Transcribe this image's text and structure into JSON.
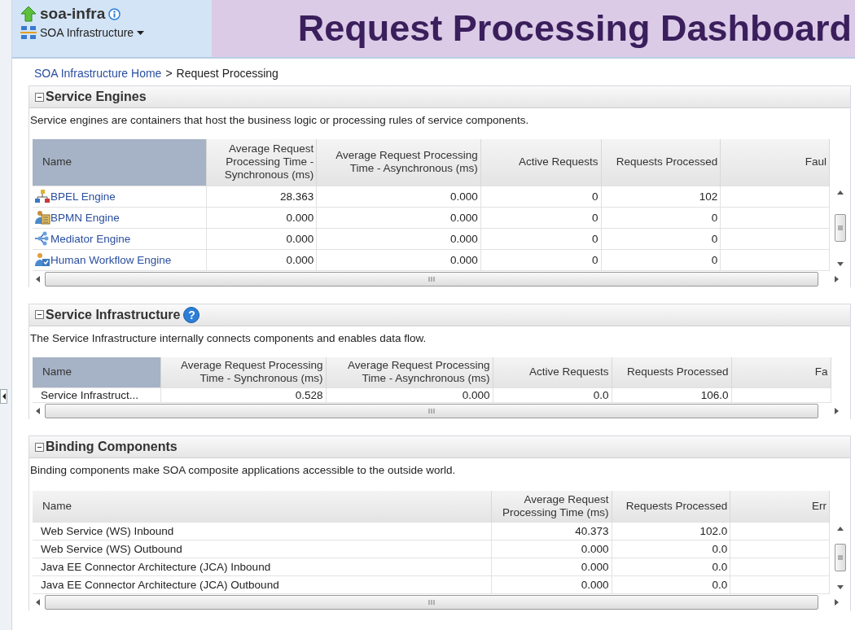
{
  "header": {
    "app_name": "soa-infra",
    "target_menu": "SOA Infrastructure",
    "title": "Request Processing Dashboard"
  },
  "breadcrumb": {
    "link": "SOA Infrastructure Home",
    "separator": ">",
    "current": "Request Processing"
  },
  "panels": [
    {
      "title": "Service Engines",
      "expanded": true,
      "description": "Service engines are containers that host the business logic or processing rules of service components.",
      "table": {
        "name_links": true,
        "vertical_scroll": true,
        "columns": [
          {
            "label": "Name",
            "selected": true
          },
          {
            "label": "Average Request Processing Time - Synchronous (ms)",
            "selected": false
          },
          {
            "label": "Average Request Processing Time - Asynchronous (ms)",
            "selected": false
          },
          {
            "label": "Active Requests",
            "selected": false
          },
          {
            "label": "Requests Processed",
            "selected": false
          },
          {
            "label": "Faul",
            "selected": false
          }
        ],
        "rows": [
          {
            "cells": [
              "BPEL Engine",
              "28.363",
              "0.000",
              "0",
              "102"
            ]
          },
          {
            "cells": [
              "BPMN Engine",
              "0.000",
              "0.000",
              "0",
              "0"
            ]
          },
          {
            "cells": [
              "Mediator Engine",
              "0.000",
              "0.000",
              "0",
              "0"
            ]
          },
          {
            "cells": [
              "Human Workflow Engine",
              "0.000",
              "0.000",
              "0",
              "0"
            ]
          }
        ]
      }
    },
    {
      "title": "Service Infrastructure",
      "help": "?",
      "expanded": true,
      "description": "The Service Infrastructure internally connects components and enables data flow.",
      "table": {
        "name_links": false,
        "vertical_scroll": false,
        "columns": [
          {
            "label": "Name",
            "selected": true
          },
          {
            "label": "Average Request Processing Time - Synchronous (ms)",
            "selected": false
          },
          {
            "label": "Average Request Processing Time - Asynchronous (ms)",
            "selected": false
          },
          {
            "label": "Active Requests",
            "selected": false
          },
          {
            "label": "Requests Processed",
            "selected": false
          },
          {
            "label": "Fa",
            "selected": false
          }
        ],
        "rows": [
          {
            "cells": [
              "Service Infrastruct...",
              "0.528",
              "0.000",
              "0.0",
              "106.0"
            ]
          }
        ]
      }
    },
    {
      "title": "Binding Components",
      "expanded": true,
      "description": "Binding components make SOA composite applications accessible to the outside world.",
      "table": {
        "name_links": false,
        "vertical_scroll": true,
        "columns": [
          {
            "label": "Name",
            "selected": false
          },
          {
            "label": "Average Request Processing Time (ms)",
            "selected": false
          },
          {
            "label": "Requests Processed",
            "selected": false
          },
          {
            "label": "Err",
            "selected": false
          }
        ],
        "rows": [
          {
            "cells": [
              "Web Service (WS) Inbound",
              "40.373",
              "102.0"
            ]
          },
          {
            "cells": [
              "Web Service (WS) Outbound",
              "0.000",
              "0.0"
            ]
          },
          {
            "cells": [
              "Java EE Connector Architecture (JCA) Inbound",
              "0.000",
              "0.0"
            ]
          },
          {
            "cells": [
              "Java EE Connector Architecture (JCA) Outbound",
              "0.000",
              "0.0"
            ]
          }
        ]
      }
    }
  ]
}
